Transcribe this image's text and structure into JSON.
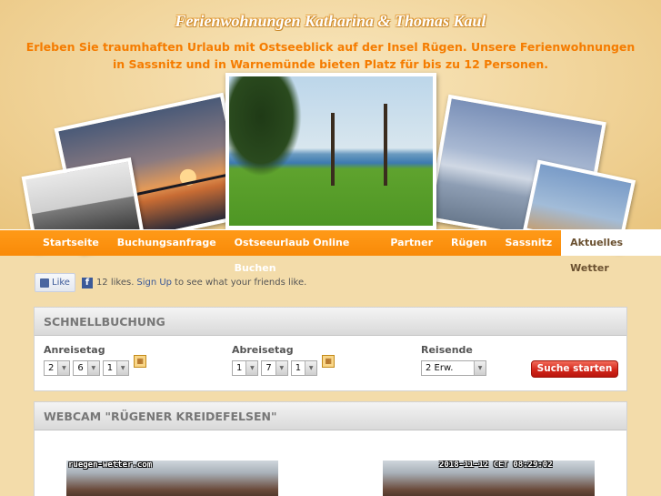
{
  "header": {
    "title": "Ferienwohnungen Katharina & Thomas Kaul",
    "subtitle": "Erleben Sie traumhaften Urlaub mit Ostseeblick auf der Insel Rügen. Unsere Ferienwohnungen in Sassnitz und in Warnemünde bieten Platz für bis zu 12 Personen."
  },
  "nav": {
    "items": [
      {
        "label": "Startseite"
      },
      {
        "label": "Buchungsanfrage"
      },
      {
        "label": "Ostseeurlaub Online Buchen"
      },
      {
        "label": "Partner"
      },
      {
        "label": "Rügen"
      },
      {
        "label": "Sassnitz"
      },
      {
        "label": "Aktuelles Wetter"
      }
    ],
    "active": "Aktuelles Wetter"
  },
  "facebook": {
    "like_label": "Like",
    "count_text": "12 likes.",
    "signup_label": "Sign Up",
    "suffix_text": "to see what your friends like."
  },
  "booking": {
    "heading": "SCHNELLBUCHUNG",
    "arrival_label": "Anreisetag",
    "arrival_values": [
      "2",
      "6",
      "1"
    ],
    "departure_label": "Abreisetag",
    "departure_values": [
      "1",
      "7",
      "1"
    ],
    "guests_label": "Reisende",
    "guests_value": "2 Erw.",
    "search_label": "Suche starten"
  },
  "webcam": {
    "heading": "WEBCAM \"RÜGENER KREIDEFELSEN\"",
    "cam1_caption": "ruegen-wetter.com",
    "cam2_caption": "2018-11-12 CET 08:29:02"
  },
  "colors": {
    "accent": "#f98a08",
    "subtitle": "#f57c00",
    "button": "#d3261a",
    "background": "#f3dcaa"
  }
}
